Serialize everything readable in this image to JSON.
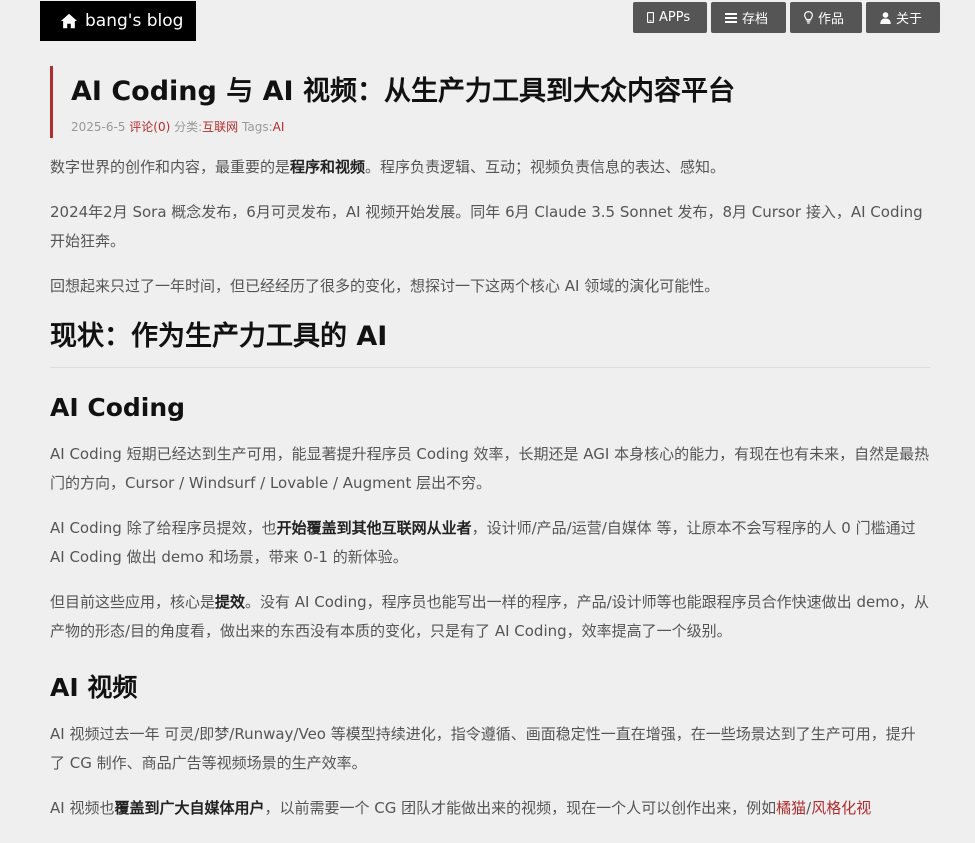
{
  "header": {
    "logo_text": "bang's blog",
    "nav": [
      {
        "label": "APPs",
        "icon": "mobile-icon"
      },
      {
        "label": "存档",
        "icon": "list-icon"
      },
      {
        "label": "作品",
        "icon": "lightbulb-icon"
      },
      {
        "label": "关于",
        "icon": "user-icon"
      }
    ]
  },
  "post": {
    "title": "AI Coding 与 AI 视频：从生产力工具到大众内容平台",
    "date": "2025-6-5",
    "comments": "评论(0)",
    "category_label": "分类:",
    "category": "互联网",
    "tags_label": "Tags:",
    "tag": "AI"
  },
  "content": {
    "p1": {
      "a": "数字世界的创作和内容，最重要的是",
      "b": "程序和视频",
      "c": "。程序负责逻辑、互动；视频负责信息的表达、感知。"
    },
    "p2": "2024年2月 Sora 概念发布，6月可灵发布，AI 视频开始发展。同年 6月 Claude 3.5 Sonnet 发布，8月 Cursor 接入，AI Coding 开始狂奔。",
    "p3": "回想起来只过了一年时间，但已经经历了很多的变化，想探讨一下这两个核心 AI 领域的演化可能性。",
    "h2_status": "现状：作为生产力工具的 AI",
    "h3_coding": "AI Coding",
    "p4": "AI Coding 短期已经达到生产可用，能显著提升程序员 Coding 效率，长期还是 AGI 本身核心的能力，有现在也有未来，自然是最热门的方向，Cursor / Windsurf / Lovable / Augment 层出不穷。",
    "p5": {
      "a": "AI Coding 除了给程序员提效，也",
      "b": "开始覆盖到其他互联网从业者",
      "c": "，设计师/产品/运营/自媒体 等，让原本不会写程序的人 0 门槛通过 AI Coding 做出 demo 和场景，带来 0-1 的新体验。"
    },
    "p6": {
      "a": "但目前这些应用，核心是",
      "b": "提效",
      "c": "。没有 AI Coding，程序员也能写出一样的程序，产品/设计师等也能跟程序员合作快速做出 demo，从产物的形态/目的角度看，做出来的东西没有本质的变化，只是有了 AI Coding，效率提高了一个级别。"
    },
    "h3_video": "AI 视频",
    "p7": "AI 视频过去一年 可灵/即梦/Runway/Veo 等模型持续进化，指令遵循、画面稳定性一直在增强，在一些场景达到了生产可用，提升了 CG 制作、商品广告等视频场景的生产效率。",
    "p8": {
      "a": "AI 视频也",
      "b": "覆盖到广大自媒体用户",
      "c": "，以前需要一个 CG 团队才能做出来的视频，现在一个人可以创作出来，例如",
      "link1": "橘猫",
      "sep": "/",
      "link2": "风格化视"
    }
  }
}
